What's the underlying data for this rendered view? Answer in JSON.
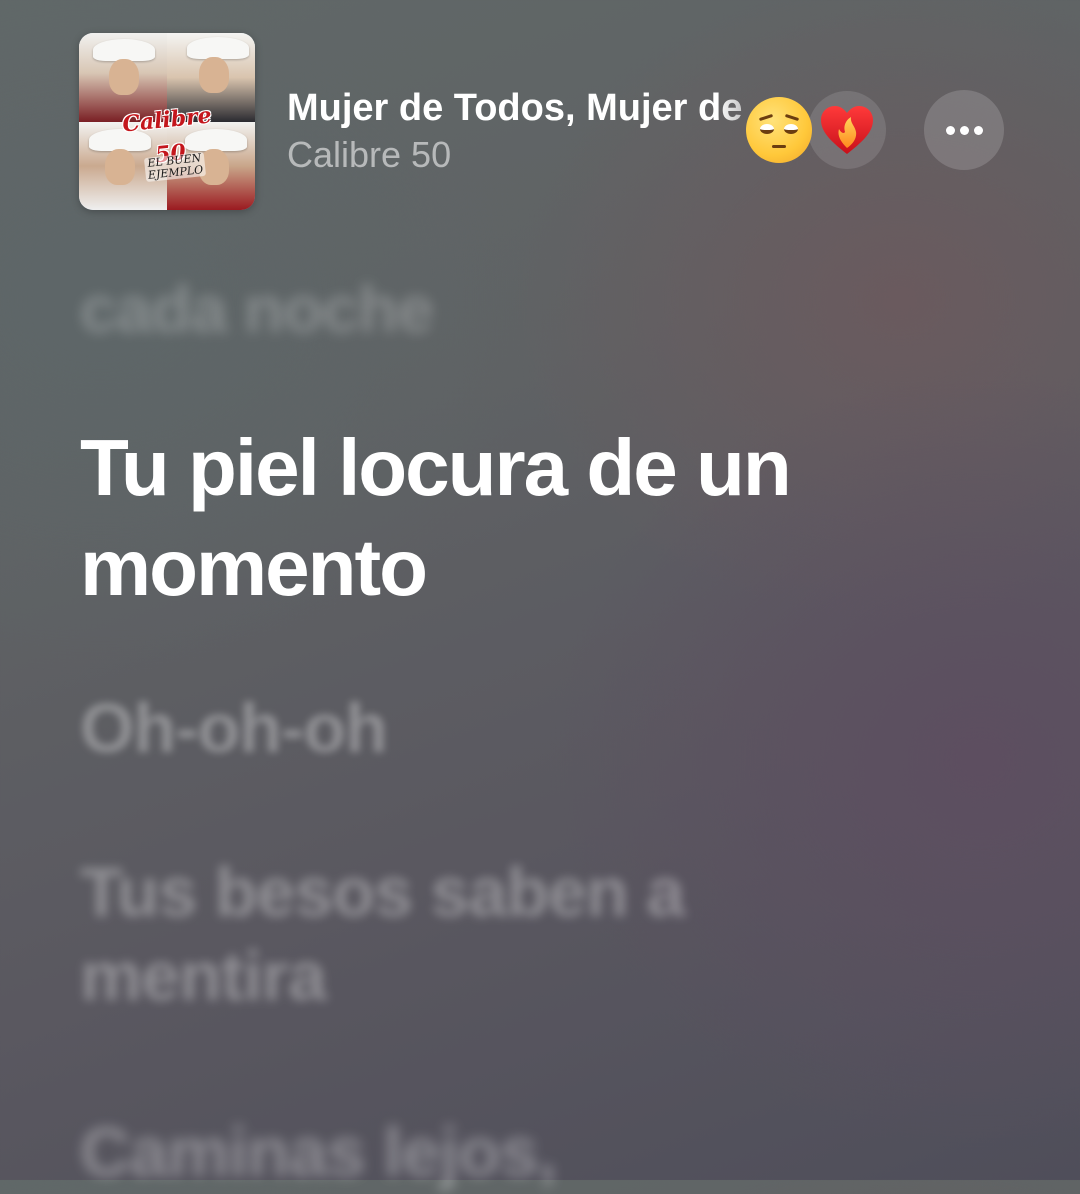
{
  "now_playing": {
    "song_title": "Mujer de Todos, Mujer de",
    "artist": "Calibre 50",
    "artwork": {
      "logo_text": "Calibre 50",
      "album_text": "EL BUEN EJEMPLO"
    }
  },
  "reactions": [
    {
      "name": "pensive-face-emoji",
      "glyph": "😔"
    },
    {
      "name": "heart-on-fire-emoji",
      "glyph": "❤️‍🔥"
    }
  ],
  "more_button": {
    "icon": "ellipsis-icon"
  },
  "lyrics": {
    "previous": "cada noche",
    "current": "Tu piel locura de un momento",
    "upcoming": [
      "Oh-oh-oh",
      "Tus besos saben a mentira",
      "Caminas lejos,"
    ]
  },
  "colors": {
    "background_top_left": "#616868",
    "background_bottom_right": "#4f4e5a",
    "active_lyric": "#ffffff",
    "inactive_lyric": "rgba(255,255,255,0.32)"
  }
}
